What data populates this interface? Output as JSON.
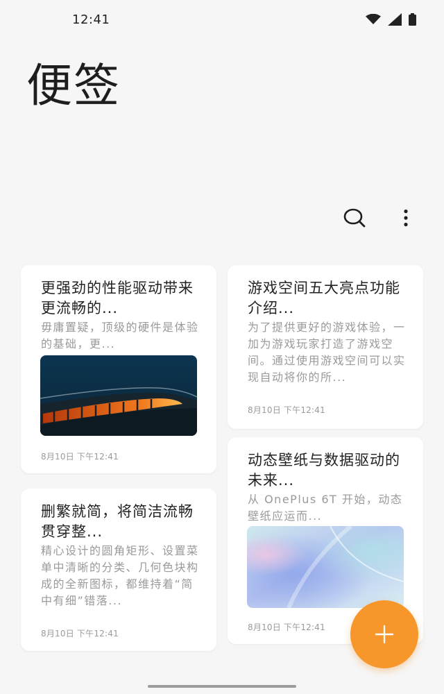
{
  "status_bar": {
    "time": "12:41"
  },
  "header": {
    "title": "便签"
  },
  "icons": {
    "search": "search-icon",
    "more": "more-vertical-icon",
    "add": "plus-icon"
  },
  "colors": {
    "accent": "#f7962a",
    "background": "#f6f6f6",
    "card": "#ffffff",
    "secondary_text": "#9a9a9a"
  },
  "notes": [
    {
      "title": "更强劲的性能驱动带来更流畅的...",
      "body": "毋庸置疑，顶级的硬件是体验的基础，更...",
      "date": "8月10日 下午12:41",
      "image": "train-at-night-image"
    },
    {
      "title": "删繁就简，将简洁流畅贯穿整...",
      "body": "精心设计的圆角矩形、设置菜单中清晰的分类、几何色块构成的全新图标，都维持着“简中有细”错落...",
      "date": "8月10日 下午12:41"
    },
    {
      "title": "游戏空间五大亮点功能介绍...",
      "body": "为了提供更好的游戏体验，一加为游戏玩家打造了游戏空间。通过使用游戏空间可以实现自动将你的所...",
      "date": "8月10日 下午12:41"
    },
    {
      "title": "动态壁纸与数据驱动的未来...",
      "body": "从 OnePlus 6T 开始，动态壁纸应运而...",
      "date": "8月10日 下午12:41",
      "image": "abstract-wallpaper-image"
    }
  ]
}
